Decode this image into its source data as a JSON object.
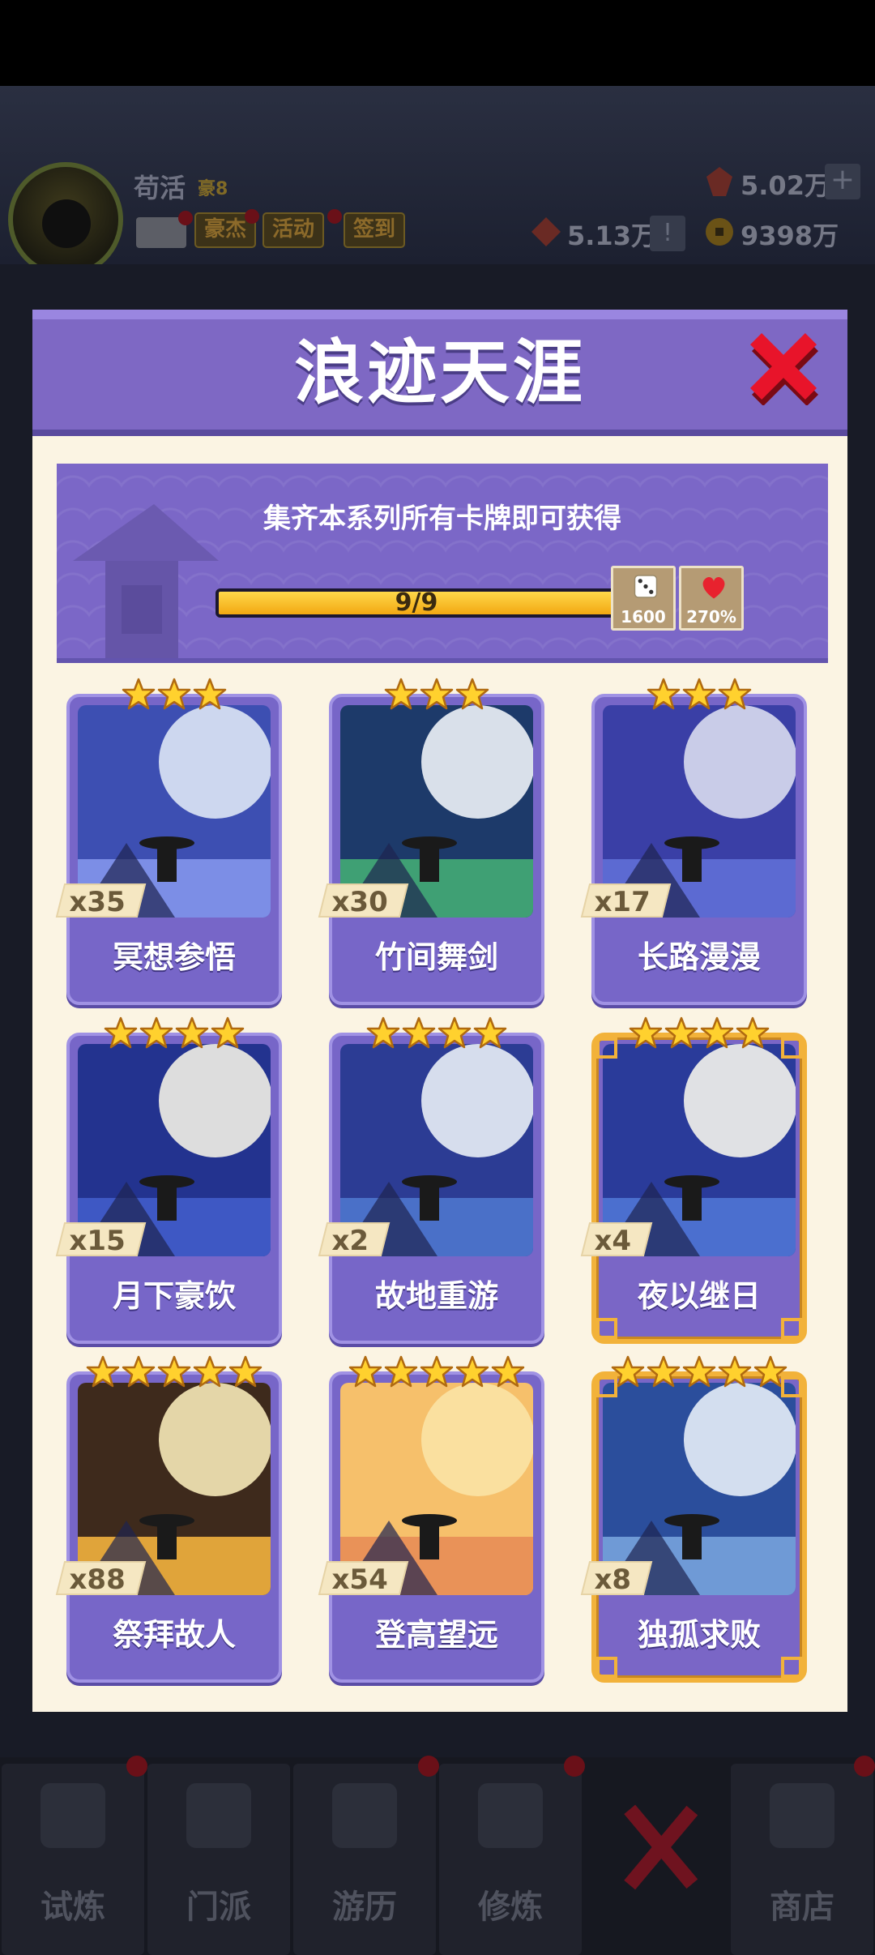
{
  "player": {
    "name": "苟活",
    "vip": "豪8"
  },
  "top_buttons": {
    "heroes": "豪杰",
    "events": "活动",
    "checkin": "签到"
  },
  "resources": {
    "gems": "5.02万",
    "power": "5.13万",
    "coins": "9398万"
  },
  "modal": {
    "title": "浪迹天涯",
    "banner_text": "集齐本系列所有卡牌即可获得",
    "progress_text": "9/9",
    "progress_fraction": 1.0,
    "rewards": [
      {
        "icon": "dice-icon",
        "value": "1600"
      },
      {
        "icon": "heart-icon",
        "value": "270%"
      }
    ]
  },
  "cards": [
    {
      "name": "冥想参悟",
      "count": "x35",
      "stars": 3,
      "rarity": "normal",
      "palette": [
        "#3d4fb2",
        "#7c8ee6",
        "#dde6f5"
      ]
    },
    {
      "name": "竹间舞剑",
      "count": "x30",
      "stars": 3,
      "rarity": "normal",
      "palette": [
        "#1d3a6a",
        "#3fa074",
        "#eef3f8"
      ]
    },
    {
      "name": "长路漫漫",
      "count": "x17",
      "stars": 3,
      "rarity": "normal",
      "palette": [
        "#3a3fa6",
        "#5c6ad2",
        "#d9dcf0"
      ]
    },
    {
      "name": "月下豪饮",
      "count": "x15",
      "stars": 4,
      "rarity": "normal",
      "palette": [
        "#23338f",
        "#3e58c4",
        "#f2f0e6"
      ]
    },
    {
      "name": "故地重游",
      "count": "x2",
      "stars": 4,
      "rarity": "normal",
      "palette": [
        "#2c3c94",
        "#4a70c8",
        "#e9eef6"
      ]
    },
    {
      "name": "夜以继日",
      "count": "x4",
      "stars": 4,
      "rarity": "gold",
      "palette": [
        "#2a3b9a",
        "#4b6fcf",
        "#f4f4ec"
      ]
    },
    {
      "name": "祭拜故人",
      "count": "x88",
      "stars": 5,
      "rarity": "normal",
      "palette": [
        "#3e2a1c",
        "#e0a43a",
        "#f6e9b8"
      ]
    },
    {
      "name": "登高望远",
      "count": "x54",
      "stars": 5,
      "rarity": "normal",
      "palette": [
        "#f6c06b",
        "#e99258",
        "#fbe3a5"
      ]
    },
    {
      "name": "独孤求败",
      "count": "x8",
      "stars": 5,
      "rarity": "gold",
      "palette": [
        "#2b4e9c",
        "#6f9ad6",
        "#e6eef8"
      ]
    }
  ],
  "nav": [
    {
      "label": "试炼"
    },
    {
      "label": "门派"
    },
    {
      "label": "游历"
    },
    {
      "label": "修炼"
    },
    {
      "label": ""
    },
    {
      "label": "商店"
    }
  ],
  "colors": {
    "accent": "#7e68c4",
    "gold": "#f2b23a",
    "close_red": "#e8142a"
  }
}
